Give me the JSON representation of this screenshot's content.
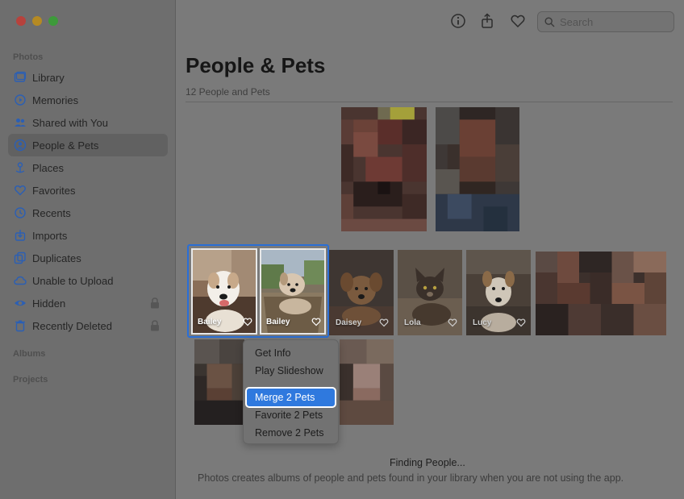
{
  "sidebar": {
    "photos_label": "Photos",
    "albums_label": "Albums",
    "projects_label": "Projects",
    "items": [
      {
        "label": "Library",
        "icon": "library-icon"
      },
      {
        "label": "Memories",
        "icon": "memories-icon"
      },
      {
        "label": "Shared with You",
        "icon": "shared-icon"
      },
      {
        "label": "People & Pets",
        "icon": "people-icon",
        "active": true
      },
      {
        "label": "Places",
        "icon": "places-icon"
      },
      {
        "label": "Favorites",
        "icon": "heart-icon"
      },
      {
        "label": "Recents",
        "icon": "clock-icon"
      },
      {
        "label": "Imports",
        "icon": "import-icon"
      },
      {
        "label": "Duplicates",
        "icon": "duplicates-icon"
      },
      {
        "label": "Unable to Upload",
        "icon": "cloud-icon"
      },
      {
        "label": "Hidden",
        "icon": "eye-icon",
        "locked": true
      },
      {
        "label": "Recently Deleted",
        "icon": "trash-icon",
        "locked": true
      }
    ]
  },
  "toolbar": {
    "search_placeholder": "Search"
  },
  "main": {
    "title": "People & Pets",
    "subtitle": "12 People and Pets",
    "tiles": [
      {
        "name": "Bailey"
      },
      {
        "name": "Bailey"
      },
      {
        "name": "Daisey"
      },
      {
        "name": "Lola"
      },
      {
        "name": "Lucy"
      }
    ],
    "finding_title": "Finding People...",
    "finding_desc": "Photos creates albums of people and pets found in your library when you are not using the app."
  },
  "context_menu": {
    "items": [
      "Get Info",
      "Play Slideshow",
      "Merge 2 Pets",
      "Favorite 2 Pets",
      "Remove 2 Pets"
    ],
    "highlighted": "Merge 2 Pets"
  },
  "colors": {
    "accent": "#2f79de",
    "selection": "#2a6fd6"
  }
}
